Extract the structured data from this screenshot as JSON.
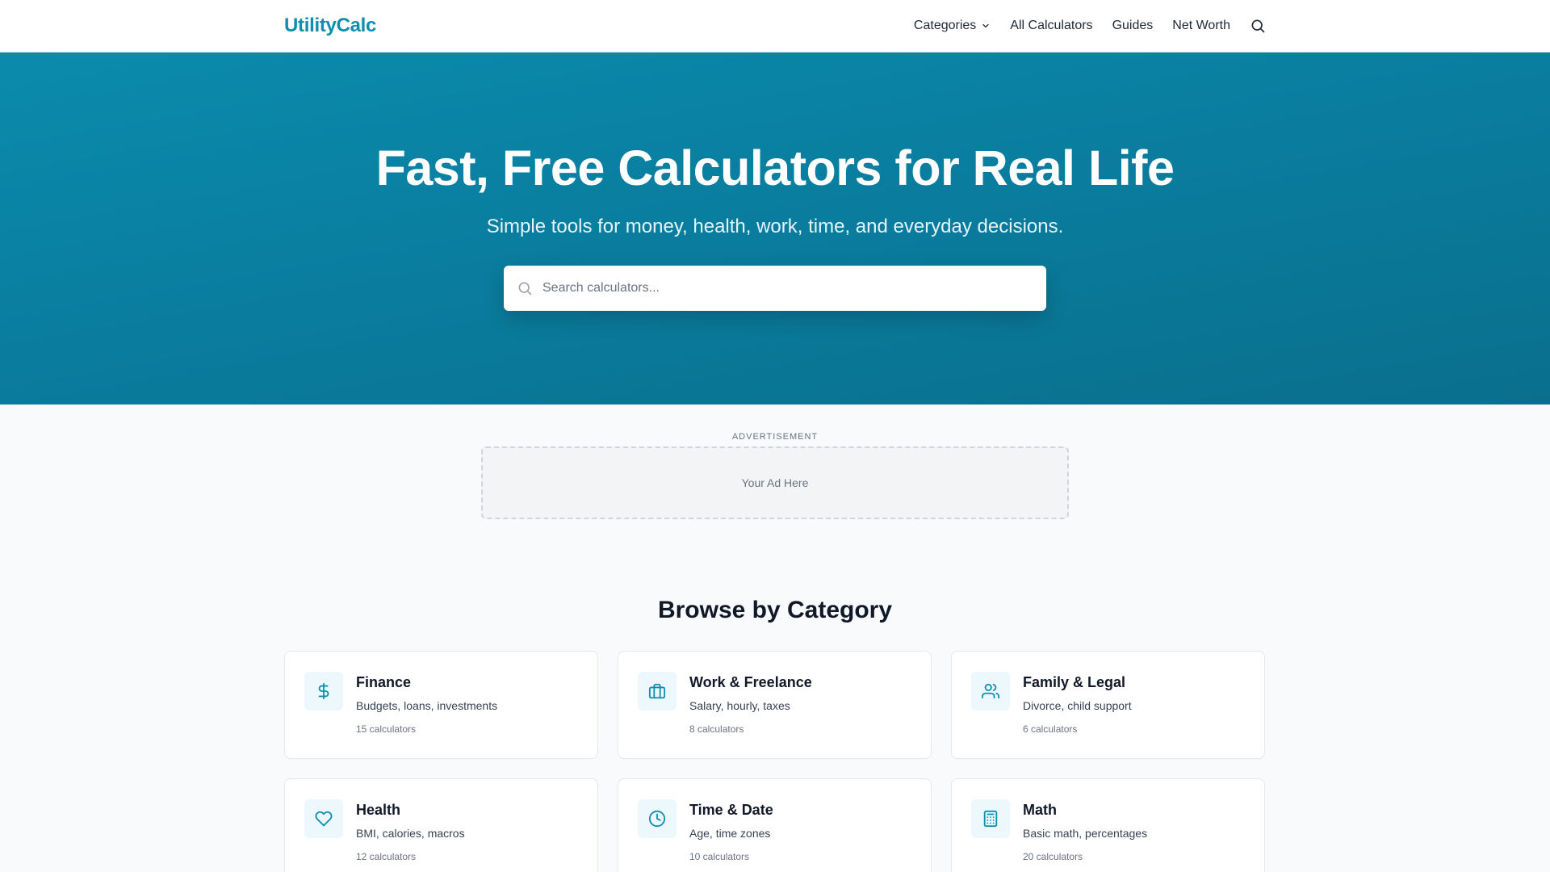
{
  "header": {
    "logo": "UtilityCalc",
    "nav": [
      {
        "label": "Categories"
      },
      {
        "label": "All Calculators"
      },
      {
        "label": "Guides"
      },
      {
        "label": "Net Worth"
      }
    ],
    "search_icon": "search-icon"
  },
  "hero": {
    "title": "Fast, Free Calculators for Real Life",
    "subtitle": "Simple tools for money, health, work, time, and everyday decisions.",
    "search_placeholder": "Search calculators..."
  },
  "ad": {
    "label": "ADVERTISEMENT",
    "text": "Your Ad Here"
  },
  "categories": {
    "title": "Browse by Category",
    "items": [
      {
        "title": "Finance",
        "desc": "Budgets, loans, investments",
        "count": "15 calculators",
        "icon": "dollar-icon"
      },
      {
        "title": "Work & Freelance",
        "desc": "Salary, hourly, taxes",
        "count": "8 calculators",
        "icon": "briefcase-icon"
      },
      {
        "title": "Family & Legal",
        "desc": "Divorce, child support",
        "count": "6 calculators",
        "icon": "users-icon"
      },
      {
        "title": "Health",
        "desc": "BMI, calories, macros",
        "count": "12 calculators",
        "icon": "heart-icon"
      },
      {
        "title": "Time & Date",
        "desc": "Age, time zones",
        "count": "10 calculators",
        "icon": "clock-icon"
      },
      {
        "title": "Math",
        "desc": "Basic math, percentages",
        "count": "20 calculators",
        "icon": "calculator-icon"
      }
    ]
  },
  "colors": {
    "brand": "#0e8fb0",
    "hero_bg": "#0a7b9c",
    "icon_bg": "#ecf8fb"
  }
}
